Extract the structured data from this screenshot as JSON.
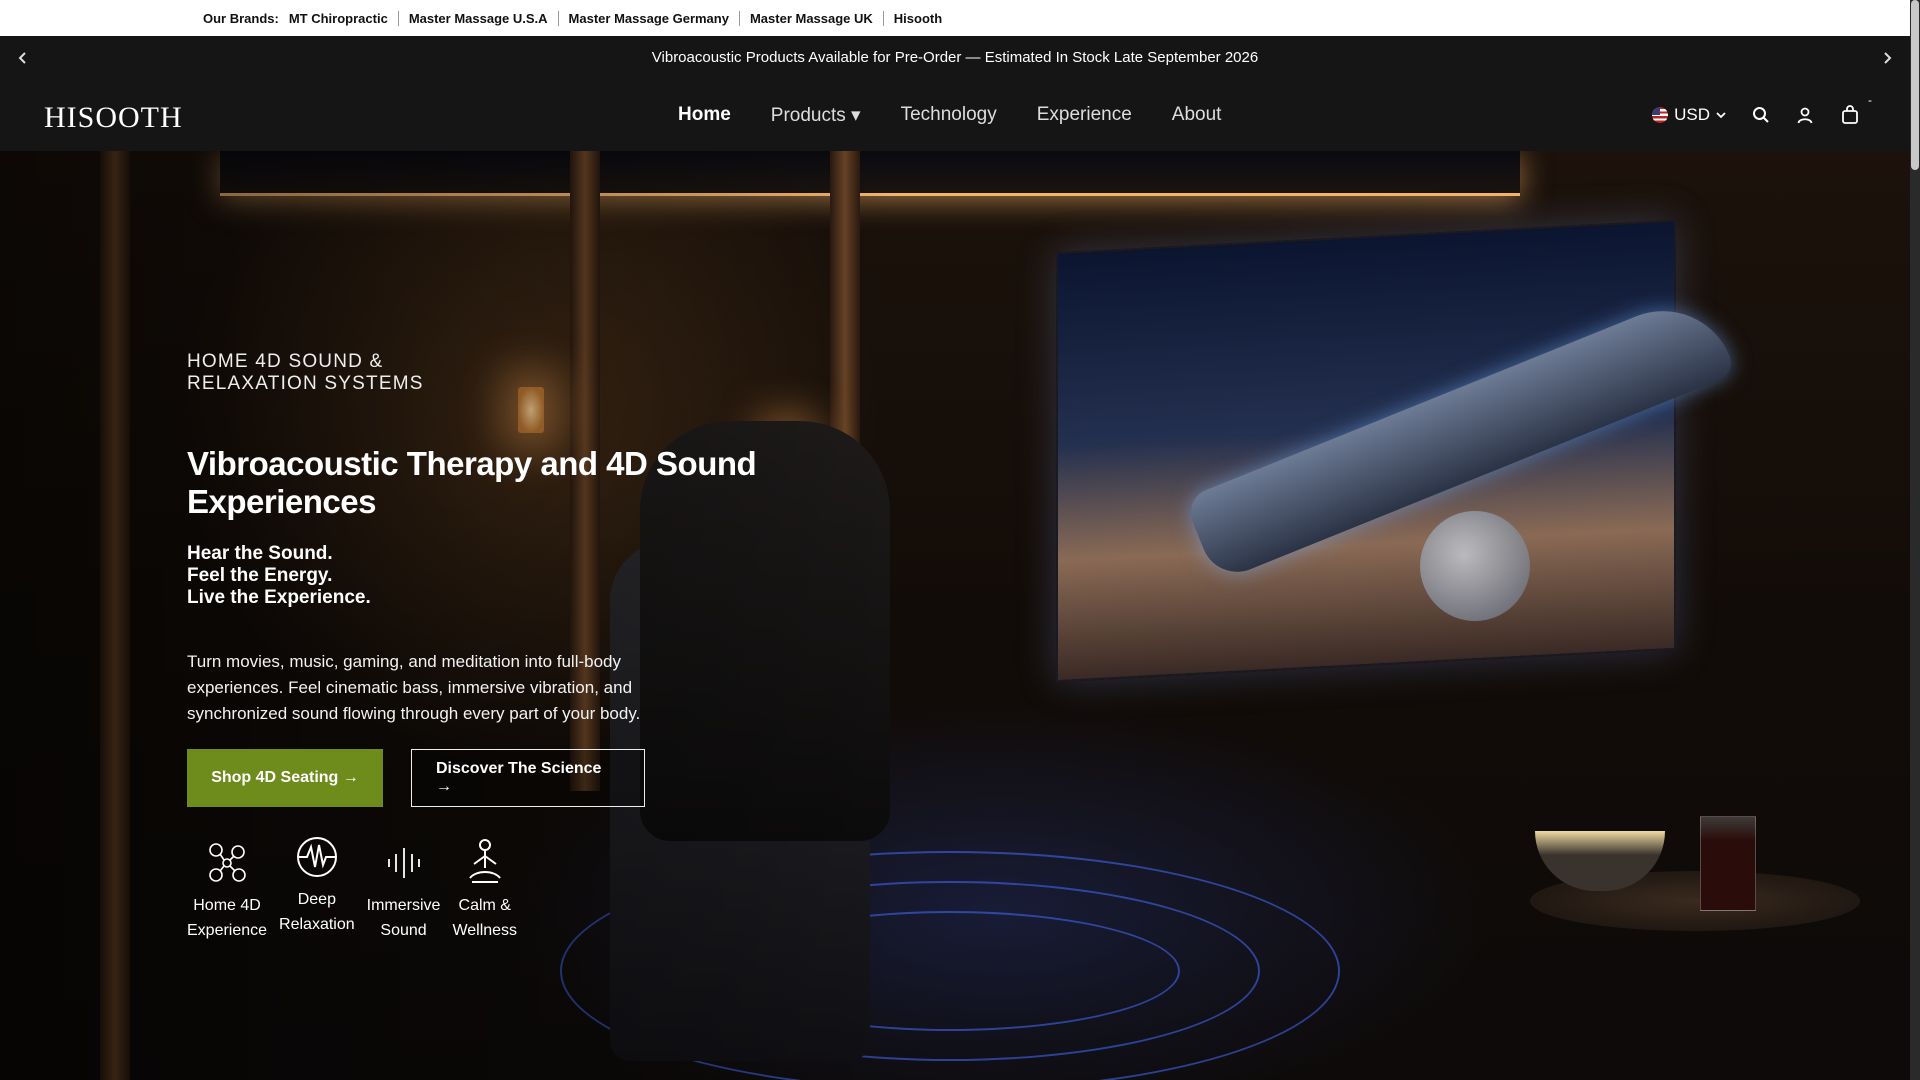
{
  "brands_bar": {
    "label": "Our Brands:",
    "brands": [
      "MT Chiropractic",
      "Master Massage U.S.A",
      "Master Massage Germany",
      "Master Massage UK",
      "Hisooth"
    ]
  },
  "announcement": {
    "text": "Vibroacoustic Products Available for Pre-Order — Estimated In Stock Late September 2026",
    "prev_icon": "chevron-left",
    "next_icon": "chevron-right"
  },
  "header": {
    "logo": "HISOOTH",
    "nav": [
      {
        "label": "Home",
        "active": true
      },
      {
        "label": "Products ▾",
        "active": false
      },
      {
        "label": "Technology",
        "active": false
      },
      {
        "label": "Experience",
        "active": false
      },
      {
        "label": "About",
        "active": false
      }
    ],
    "currency": "USD",
    "cart_count": "-"
  },
  "hero": {
    "eyebrow": "HOME 4D SOUND & RELAXATION SYSTEMS",
    "headline": "Vibroacoustic Therapy and 4D Sound Experiences",
    "taglines": [
      "Hear the Sound.",
      "Feel the Energy.",
      "Live the Experience."
    ],
    "description": "Turn movies, music, gaming, and meditation into full-body experiences. Feel cinematic bass, immersive vibration, and synchronized sound flowing through every part of your body.",
    "cta_primary": "Shop 4D Seating →",
    "cta_secondary": "Discover The Science →",
    "features": [
      {
        "icon": "molecule-icon",
        "label_1": "Home 4D",
        "label_2": "Experience"
      },
      {
        "icon": "pulse-icon",
        "label_1": "Deep",
        "label_2": "Relaxation"
      },
      {
        "icon": "soundwave-icon",
        "label_1": "Immersive",
        "label_2": "Sound"
      },
      {
        "icon": "meditation-icon",
        "label_1": "Calm &",
        "label_2": "Wellness"
      }
    ]
  },
  "colors": {
    "primary_button": "#6e8c1b",
    "header_bg": "#151515"
  }
}
